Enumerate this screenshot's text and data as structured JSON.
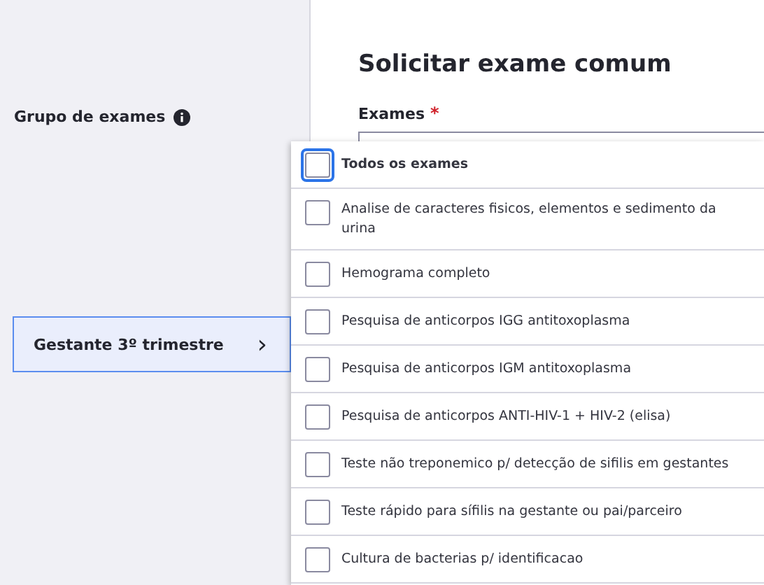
{
  "sidebar": {
    "group_label": "Grupo de exames",
    "group_item": {
      "label": "Gestante 3º trimestre",
      "selected": true,
      "chevron": "›"
    }
  },
  "main": {
    "title": "Solicitar exame comum",
    "field_label": "Exames",
    "required_mark": "*"
  },
  "dropdown": {
    "items": [
      {
        "label": "Todos os exames",
        "kind": "all",
        "checked": false,
        "focused": true
      },
      {
        "label": "Analise de caracteres fisicos, elementos e sedimento da urina",
        "kind": "exam",
        "checked": false,
        "focused": false
      },
      {
        "label": "Hemograma completo",
        "kind": "exam",
        "checked": false,
        "focused": false
      },
      {
        "label": "Pesquisa de anticorpos IGG antitoxoplasma",
        "kind": "exam",
        "checked": false,
        "focused": false
      },
      {
        "label": "Pesquisa de anticorpos IGM antitoxoplasma",
        "kind": "exam",
        "checked": false,
        "focused": false
      },
      {
        "label": "Pesquisa de anticorpos ANTI-HIV-1 + HIV-2 (elisa)",
        "kind": "exam",
        "checked": false,
        "focused": false
      },
      {
        "label": "Teste não treponemico p/ detecção de sifilis em gestantes",
        "kind": "exam",
        "checked": false,
        "focused": false
      },
      {
        "label": "Teste rápido para sífilis na gestante ou pai/parceiro",
        "kind": "exam",
        "checked": false,
        "focused": false
      },
      {
        "label": "Cultura de bacterias p/ identificacao",
        "kind": "exam",
        "checked": false,
        "focused": false
      }
    ]
  }
}
